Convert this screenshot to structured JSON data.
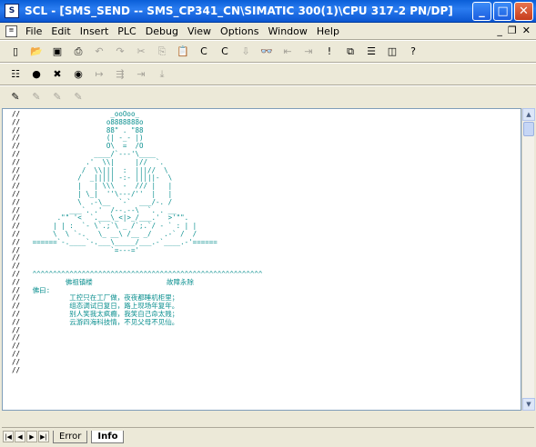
{
  "window": {
    "app_icon": "scl-app-icon",
    "title": "SCL  - [SMS_SEND -- SMS_CP341_CN\\SIMATIC 300(1)\\CPU 317-2 PN/DP]",
    "minimize": "_",
    "maximize": "□",
    "close": "✕"
  },
  "menu": {
    "items": [
      "File",
      "Edit",
      "Insert",
      "PLC",
      "Debug",
      "View",
      "Options",
      "Window",
      "Help"
    ],
    "mdi_min": "_",
    "mdi_restore": "❐",
    "mdi_close": "✕"
  },
  "toolbar1": {
    "buttons": [
      {
        "name": "new-icon",
        "glyph": "▯",
        "enabled": true
      },
      {
        "name": "open-icon",
        "glyph": "📂",
        "enabled": true
      },
      {
        "name": "save-icon",
        "glyph": "▣",
        "enabled": true
      },
      {
        "name": "print-icon",
        "glyph": "⎙",
        "enabled": true
      },
      {
        "name": "undo-icon",
        "glyph": "↶",
        "enabled": false
      },
      {
        "name": "redo-icon",
        "glyph": "↷",
        "enabled": false
      },
      {
        "name": "cut-icon",
        "glyph": "✂",
        "enabled": false
      },
      {
        "name": "copy-icon",
        "glyph": "⎘",
        "enabled": false
      },
      {
        "name": "paste-icon",
        "glyph": "📋",
        "enabled": false
      },
      {
        "name": "compile-icon",
        "glyph": "C",
        "enabled": true
      },
      {
        "name": "compile-all-icon",
        "glyph": "C",
        "enabled": true
      },
      {
        "name": "download-icon",
        "glyph": "⇩",
        "enabled": false
      },
      {
        "name": "monitor-icon",
        "glyph": "👓",
        "enabled": true
      },
      {
        "name": "breakpoint-prev-icon",
        "glyph": "⇤",
        "enabled": false
      },
      {
        "name": "breakpoint-next-icon",
        "glyph": "⇥",
        "enabled": false
      },
      {
        "name": "exclamation-icon",
        "glyph": "!",
        "enabled": true
      },
      {
        "name": "cascade-icon",
        "glyph": "⧉",
        "enabled": true
      },
      {
        "name": "tile-horizontal-icon",
        "glyph": "☰",
        "enabled": true
      },
      {
        "name": "tile-vertical-icon",
        "glyph": "◫",
        "enabled": true
      },
      {
        "name": "help-icon",
        "glyph": "?",
        "enabled": true
      }
    ]
  },
  "toolbar2": {
    "buttons": [
      {
        "name": "list-icon",
        "glyph": "☷",
        "enabled": true
      },
      {
        "name": "breakpoint-icon",
        "glyph": "●",
        "enabled": true
      },
      {
        "name": "delete-breakpoint-icon",
        "glyph": "✖",
        "enabled": true
      },
      {
        "name": "disable-breakpoint-icon",
        "glyph": "◉",
        "enabled": true
      },
      {
        "name": "step-over-icon",
        "glyph": "↦",
        "enabled": false
      },
      {
        "name": "step-into-icon",
        "glyph": "⇶",
        "enabled": false
      },
      {
        "name": "step-out-icon",
        "glyph": "⇥",
        "enabled": false
      },
      {
        "name": "run-to-cursor-icon",
        "glyph": "⤓",
        "enabled": false
      }
    ]
  },
  "toolbar3": {
    "buttons": [
      {
        "name": "bookmark-icon",
        "glyph": "✎",
        "enabled": true
      },
      {
        "name": "bookmark-next-icon",
        "glyph": "✎",
        "enabled": false
      },
      {
        "name": "bookmark-prev-icon",
        "glyph": "✎",
        "enabled": false
      },
      {
        "name": "bookmark-clear-icon",
        "glyph": "✎",
        "enabled": false
      }
    ]
  },
  "editor": {
    "comment_prefix": "//",
    "line_count": 33,
    "art_lines": [
      "                    _ooOoo_",
      "                   o8888888o",
      "                   88\" . \"88",
      "                   (| -_- |)",
      "                   O\\  =  /O",
      "                ____/`---'\\____",
      "              .'  \\\\|     |//  `.",
      "             /  \\\\|||  :  |||//  \\",
      "            /  _||||| -:- |||||-  \\",
      "            |   | \\\\\\  -  /// |   |",
      "            | \\_|  ''\\---/''  |   |",
      "            \\  .-\\__  `-`  ___/-. /",
      "          ___`. .'  /--.--\\  `. . __",
      "       .\"\" '<  `.___\\_<|>_/___.'  >'\"\".",
      "      | | :  `- \\`.;`\\ _ /`;.`/ - ` : | |",
      "      \\  \\ `-.   \\_ __\\ /__ _/   .-` /  /",
      " ======`-.____`-.___\\_____/___.-`____.-'======",
      "                    `=---='",
      "",
      "",
      " ^^^^^^^^^^^^^^^^^^^^^^^^^^^^^^^^^^^^^^^^^^^^^^^^^^^^^^^^"
    ],
    "blessing": "佛祖镇楼                  故障永除",
    "poem_title": "佛曰:",
    "poem": [
      "工控只在工厂做，夜夜都睡机柜里；",
      "组态调试日复日，路上现场年复年。",
      "别人笑我太疯癫，我笑自己命太贱；",
      "云游四海科技情，不见父母不见仙。"
    ]
  },
  "bottom_tabs": {
    "nav_first": "|◀",
    "nav_prev": "◀",
    "nav_next": "▶",
    "nav_last": "▶|",
    "tabs": [
      "Error",
      "Info"
    ],
    "active": "Info"
  }
}
